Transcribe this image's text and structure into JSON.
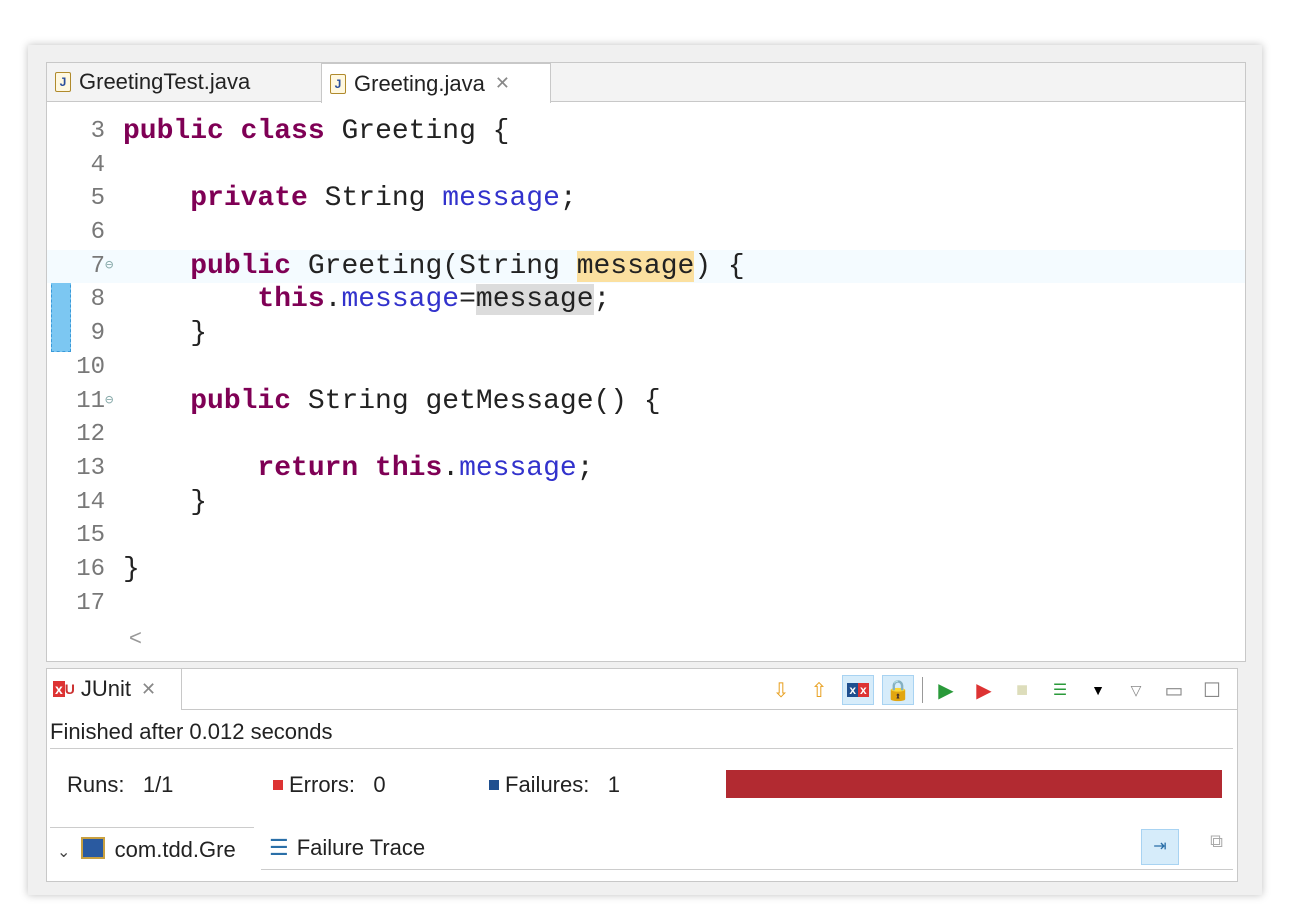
{
  "editor": {
    "tabs": [
      {
        "label": "GreetingTest.java",
        "icon": "java-file-icon",
        "active": false
      },
      {
        "label": "Greeting.java",
        "icon": "java-file-icon",
        "active": true
      }
    ],
    "lines": [
      {
        "n": "3",
        "t": [
          [
            "kw",
            "public"
          ],
          [
            "",
            ""
          ],
          [
            "",
            " "
          ],
          [
            "kw",
            "class"
          ],
          [
            "",
            " Greeting {"
          ]
        ]
      },
      {
        "n": "4",
        "t": []
      },
      {
        "n": "5",
        "t": [
          [
            "",
            "    "
          ],
          [
            "kw",
            "private"
          ],
          [
            "",
            " String "
          ],
          [
            "fld",
            "message"
          ],
          [
            "",
            ";"
          ]
        ]
      },
      {
        "n": "6",
        "t": []
      },
      {
        "n": "7",
        "fold": true,
        "cur": true,
        "t": [
          [
            "",
            "    "
          ],
          [
            "kw",
            "public"
          ],
          [
            "",
            " Greeting(String "
          ],
          [
            "hl",
            "message"
          ],
          [
            "",
            ") {"
          ]
        ]
      },
      {
        "n": "8",
        "t": [
          [
            "",
            "        "
          ],
          [
            "kw",
            "this"
          ],
          [
            "",
            "."
          ],
          [
            "fld",
            "message"
          ],
          [
            "",
            "="
          ],
          [
            "hl2",
            "message"
          ],
          [
            "",
            ";"
          ]
        ]
      },
      {
        "n": "9",
        "t": [
          [
            "",
            "    }"
          ]
        ]
      },
      {
        "n": "10",
        "t": []
      },
      {
        "n": "11",
        "fold": true,
        "t": [
          [
            "",
            "    "
          ],
          [
            "kw",
            "public"
          ],
          [
            "",
            " String getMessage() {"
          ]
        ]
      },
      {
        "n": "12",
        "t": []
      },
      {
        "n": "13",
        "t": [
          [
            "",
            "        "
          ],
          [
            "kw",
            "return"
          ],
          [
            "kw",
            " this"
          ],
          [
            "",
            "."
          ],
          [
            "fld",
            "message"
          ],
          [
            "",
            ";"
          ]
        ]
      },
      {
        "n": "14",
        "t": [
          [
            "",
            "    }"
          ]
        ]
      },
      {
        "n": "15",
        "t": []
      },
      {
        "n": "16",
        "t": [
          [
            "",
            "}"
          ]
        ]
      },
      {
        "n": "17",
        "t": []
      }
    ],
    "scroll_left": "<"
  },
  "junit": {
    "tab_label": "JUnit",
    "finished": "Finished after 0.012 seconds",
    "runs_label": "Runs:",
    "runs_value": "1/1",
    "errors_label": "Errors:",
    "errors_value": "0",
    "failures_label": "Failures:",
    "failures_value": "1",
    "progress_percent": 100,
    "progress_color": "#b22a31",
    "tree_item": "com.tdd.Gre",
    "failure_trace_label": "Failure Trace"
  }
}
